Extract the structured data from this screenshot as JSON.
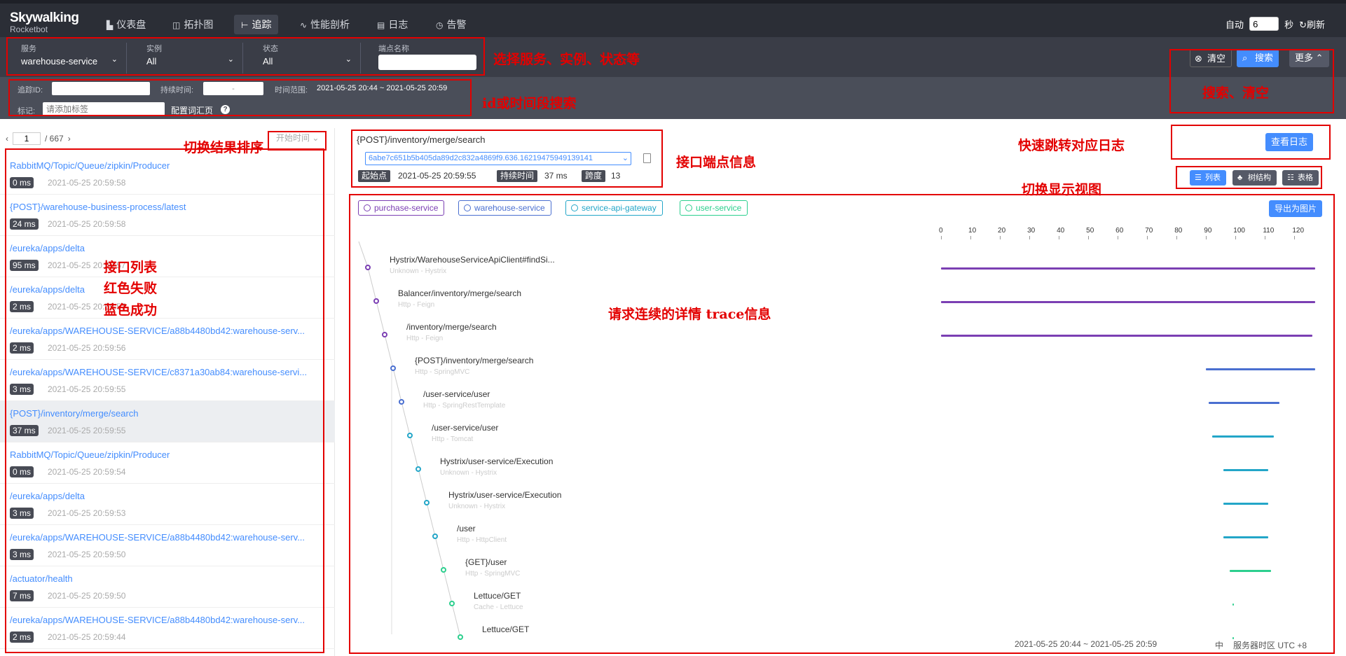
{
  "app": {
    "logo": "Skywalking",
    "sub": "Rocketbot"
  },
  "nav": [
    {
      "icon": "chart-icon",
      "label": "仪表盘"
    },
    {
      "icon": "topology-icon",
      "label": "拓扑图"
    },
    {
      "icon": "trace-icon",
      "label": "追踪"
    },
    {
      "icon": "profile-icon",
      "label": "性能剖析"
    },
    {
      "icon": "log-icon",
      "label": "日志"
    },
    {
      "icon": "alarm-icon",
      "label": "告警"
    }
  ],
  "auto": {
    "label": "自动",
    "value": "6",
    "unit": "秒",
    "refresh": "刷新"
  },
  "filters": {
    "service": {
      "label": "服务",
      "value": "warehouse-service"
    },
    "instance": {
      "label": "实例",
      "value": "All"
    },
    "status": {
      "label": "状态",
      "value": "All"
    },
    "endpoint": {
      "label": "端点名称",
      "value": ""
    }
  },
  "actions": {
    "clear": "清空",
    "search": "搜索",
    "more": "更多"
  },
  "search2": {
    "trace_id": "追踪ID:",
    "duration": "持续时间:",
    "dash": "-",
    "range_label": "时间范围:",
    "range": "2021-05-25 20:44 ~ 2021-05-25 20:59",
    "tags_label": "标记:",
    "tags_placeholder": "请添加标签",
    "vocab": "配置词汇页"
  },
  "pager": {
    "page": "1",
    "total": "/ 667",
    "sort": "开始时间"
  },
  "traces": [
    {
      "ep": "RabbitMQ/Topic/Queue/zipkin/Producer",
      "ms": "0 ms",
      "time": "2021-05-25 20:59:58"
    },
    {
      "ep": "{POST}/warehouse-business-process/latest",
      "ms": "24 ms",
      "time": "2021-05-25 20:59:58"
    },
    {
      "ep": "/eureka/apps/delta",
      "ms": "95 ms",
      "time": "2021-05-25 20:59:57"
    },
    {
      "ep": "/eureka/apps/delta",
      "ms": "2 ms",
      "time": "2021-05-25 20:59:57"
    },
    {
      "ep": "/eureka/apps/WAREHOUSE-SERVICE/a88b4480bd42:warehouse-serv...",
      "ms": "2 ms",
      "time": "2021-05-25 20:59:56"
    },
    {
      "ep": "/eureka/apps/WAREHOUSE-SERVICE/c8371a30ab84:warehouse-servi...",
      "ms": "3 ms",
      "time": "2021-05-25 20:59:55"
    },
    {
      "ep": "{POST}/inventory/merge/search",
      "ms": "37 ms",
      "time": "2021-05-25 20:59:55"
    },
    {
      "ep": "RabbitMQ/Topic/Queue/zipkin/Producer",
      "ms": "0 ms",
      "time": "2021-05-25 20:59:54"
    },
    {
      "ep": "/eureka/apps/delta",
      "ms": "3 ms",
      "time": "2021-05-25 20:59:53"
    },
    {
      "ep": "/eureka/apps/WAREHOUSE-SERVICE/a88b4480bd42:warehouse-serv...",
      "ms": "3 ms",
      "time": "2021-05-25 20:59:50"
    },
    {
      "ep": "/actuator/health",
      "ms": "7 ms",
      "time": "2021-05-25 20:59:50"
    },
    {
      "ep": "/eureka/apps/WAREHOUSE-SERVICE/a88b4480bd42:warehouse-serv...",
      "ms": "2 ms",
      "time": "2021-05-25 20:59:44"
    }
  ],
  "detail": {
    "title": "{POST}/inventory/merge/search",
    "trace_id": "6abe7c651b5b405da89d2c832a4869f9.636.16219475949139141",
    "start_label": "起始点",
    "start": "2021-05-25 20:59:55",
    "duration_label": "持续时间",
    "duration": "37 ms",
    "span_label": "跨度",
    "span": "13",
    "view_log": "查看日志",
    "views": [
      "列表",
      "树结构",
      "表格"
    ],
    "export": "导出为图片"
  },
  "services": [
    {
      "name": "purchase-service",
      "color": "#7b3fb3"
    },
    {
      "name": "warehouse-service",
      "color": "#4a6fd0"
    },
    {
      "name": "service-api-gateway",
      "color": "#23a6c8"
    },
    {
      "name": "user-service",
      "color": "#2ccf8e"
    }
  ],
  "ticks": [
    "0",
    "10",
    "20",
    "30",
    "40",
    "50",
    "60",
    "70",
    "80",
    "90",
    "100",
    "110",
    "120"
  ],
  "spans": [
    {
      "name": "Hystrix/WarehouseServiceApiClient#findSi...",
      "sub": "Unknown - Hystrix",
      "color": "#7b3fb3",
      "start": 0,
      "end": 127
    },
    {
      "name": "Balancer/inventory/merge/search",
      "sub": "Http - Feign",
      "color": "#7b3fb3",
      "start": 0,
      "end": 127
    },
    {
      "name": "/inventory/merge/search",
      "sub": "Http - Feign",
      "color": "#7b3fb3",
      "start": 0,
      "end": 126
    },
    {
      "name": "{POST}/inventory/merge/search",
      "sub": "Http - SpringMVC",
      "color": "#4a6fd0",
      "start": 90,
      "end": 127
    },
    {
      "name": "/user-service/user",
      "sub": "Http - SpringRestTemplate",
      "color": "#4a6fd0",
      "start": 91,
      "end": 115
    },
    {
      "name": "/user-service/user",
      "sub": "Http - Tomcat",
      "color": "#23a6c8",
      "start": 92,
      "end": 113
    },
    {
      "name": "Hystrix/user-service/Execution",
      "sub": "Unknown - Hystrix",
      "color": "#23a6c8",
      "start": 96,
      "end": 111
    },
    {
      "name": "Hystrix/user-service/Execution",
      "sub": "Unknown - Hystrix",
      "color": "#23a6c8",
      "start": 96,
      "end": 111
    },
    {
      "name": "/user",
      "sub": "Http - HttpClient",
      "color": "#23a6c8",
      "start": 96,
      "end": 111
    },
    {
      "name": "{GET}/user",
      "sub": "Http - SpringMVC",
      "color": "#2ccf8e",
      "start": 98,
      "end": 112
    },
    {
      "name": "Lettuce/GET",
      "sub": "Cache - Lettuce",
      "color": "#2ccf8e",
      "start": 99,
      "end": 99.5
    },
    {
      "name": "Lettuce/GET",
      "sub": "",
      "color": "#2ccf8e",
      "start": 99,
      "end": 99.5
    }
  ],
  "footer": {
    "range": "2021-05-25 20:44 ~ 2021-05-25 20:59",
    "lang": "中",
    "tz": "服务器时区 UTC +8"
  },
  "annotations": {
    "a1": "选择服务、实例、状态等",
    "a2": "id或时间段搜索",
    "a3": "搜索、清空",
    "a4": "切换结果排序",
    "a5": "接口端点信息",
    "a6": "快速跳转对应日志",
    "a7": "切换显示视图",
    "a8a": "接口列表",
    "a8b": "红色失败",
    "a8c": "蓝色成功",
    "a9": "请求连续的详情 trace信息"
  }
}
